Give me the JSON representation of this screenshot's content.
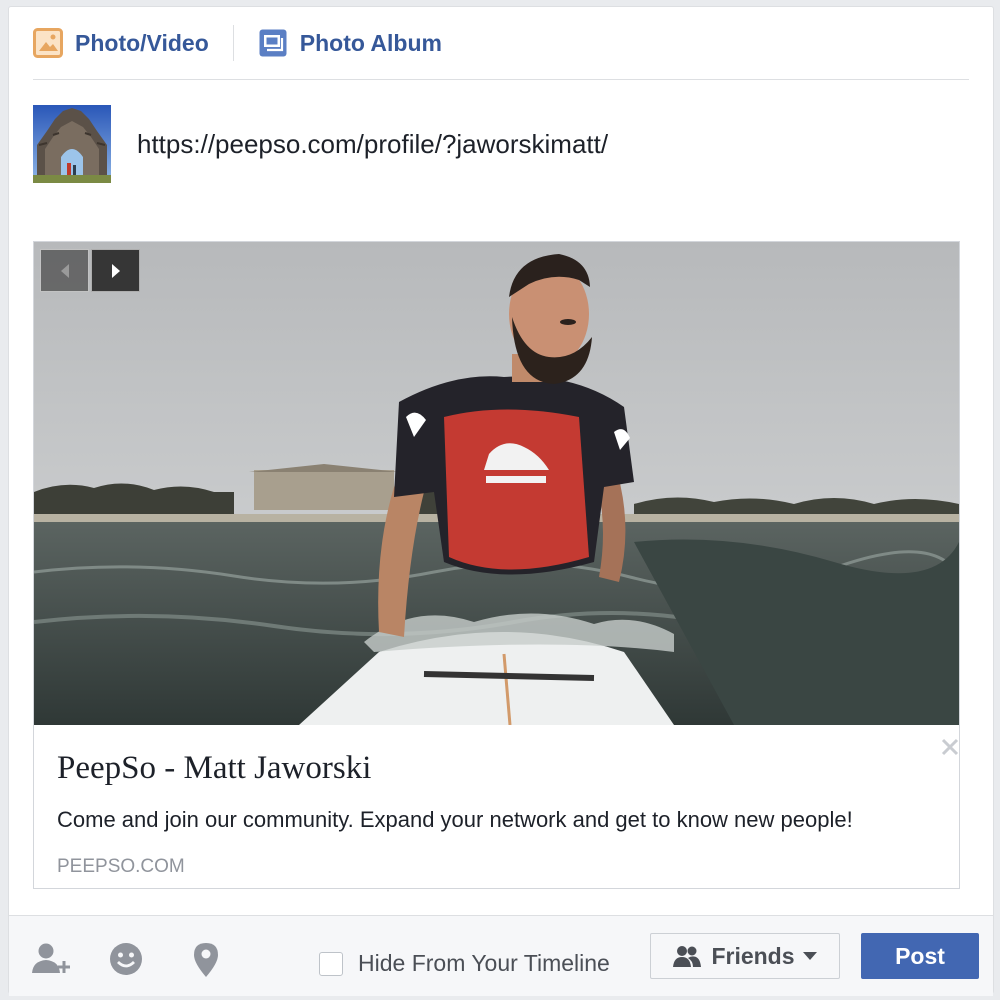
{
  "actions": {
    "photo_video": "Photo/Video",
    "photo_album": "Photo Album"
  },
  "composer": {
    "url_text": "https://peepso.com/profile/?jaworskimatt/"
  },
  "preview": {
    "title": "PeepSo - Matt Jaworski",
    "description": "Come and join our community. Expand your network and get to know new people!",
    "domain": "PEEPSO.COM",
    "image_icon": "surfer-photo"
  },
  "footer": {
    "tag_icon": "add-person-icon",
    "feeling_icon": "smiley-icon",
    "location_icon": "map-pin-icon",
    "hide_label": "Hide From Your Timeline",
    "audience_label": "Friends",
    "post_label": "Post"
  },
  "colors": {
    "link_blue": "#365899",
    "post_button": "#4267b2",
    "photo_icon_orange": "#e7a660",
    "album_icon_blue": "#5b7fc4"
  }
}
